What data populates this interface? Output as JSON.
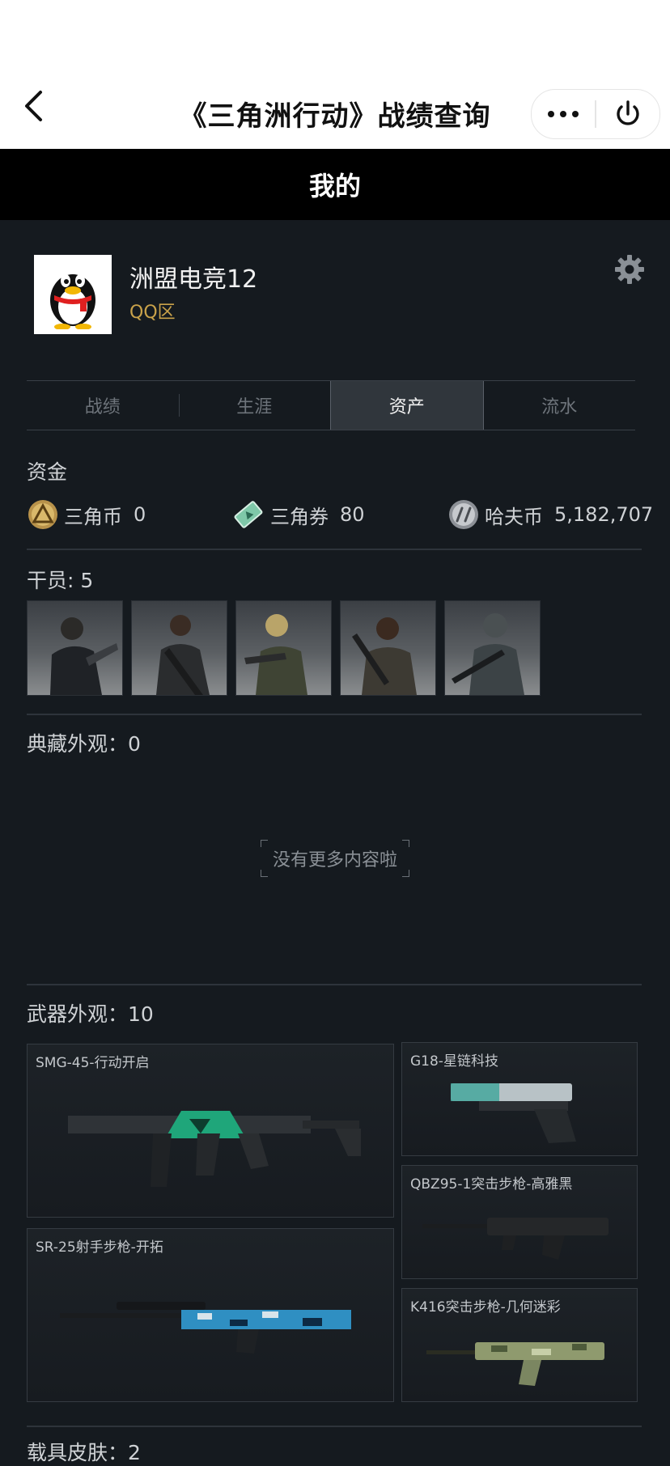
{
  "app_bar": {
    "title": "《三角洲行动》战绩查询",
    "back_icon": "chevron-left-icon",
    "more_icon": "more-dots-icon",
    "power_icon": "power-icon"
  },
  "page": {
    "header": "我的"
  },
  "profile": {
    "username": "洲盟电竞12",
    "region": "QQ区",
    "avatar_icon": "qq-penguin-icon",
    "settings_icon": "gear-icon"
  },
  "tabs": [
    {
      "label": "战绩",
      "active": false
    },
    {
      "label": "生涯",
      "active": false
    },
    {
      "label": "资产",
      "active": true
    },
    {
      "label": "流水",
      "active": false
    }
  ],
  "funds": {
    "label": "资金",
    "items": [
      {
        "name": "三角币",
        "value": "0",
        "icon": "triangle-coin-icon"
      },
      {
        "name": "三角券",
        "value": "80",
        "icon": "triangle-ticket-icon"
      },
      {
        "name": "哈夫币",
        "value": "5,182,707",
        "icon": "haf-coin-icon"
      }
    ]
  },
  "operators": {
    "label": "干员: 5",
    "count": 5
  },
  "collection": {
    "label": "典藏外观：0",
    "empty_text": "没有更多内容啦"
  },
  "weapons": {
    "label": "武器外观：10",
    "items": [
      "SMG-45-行动开启",
      "G18-星链科技",
      "QBZ95-1突击步枪-高雅黑",
      "SR-25射手步枪-开拓",
      "K416突击步枪-几何迷彩"
    ]
  },
  "next_section": {
    "label": "载具皮肤：2"
  },
  "colors": {
    "accent_gold": "#c9a24a",
    "background": "#151a1f",
    "header": "#000000"
  }
}
